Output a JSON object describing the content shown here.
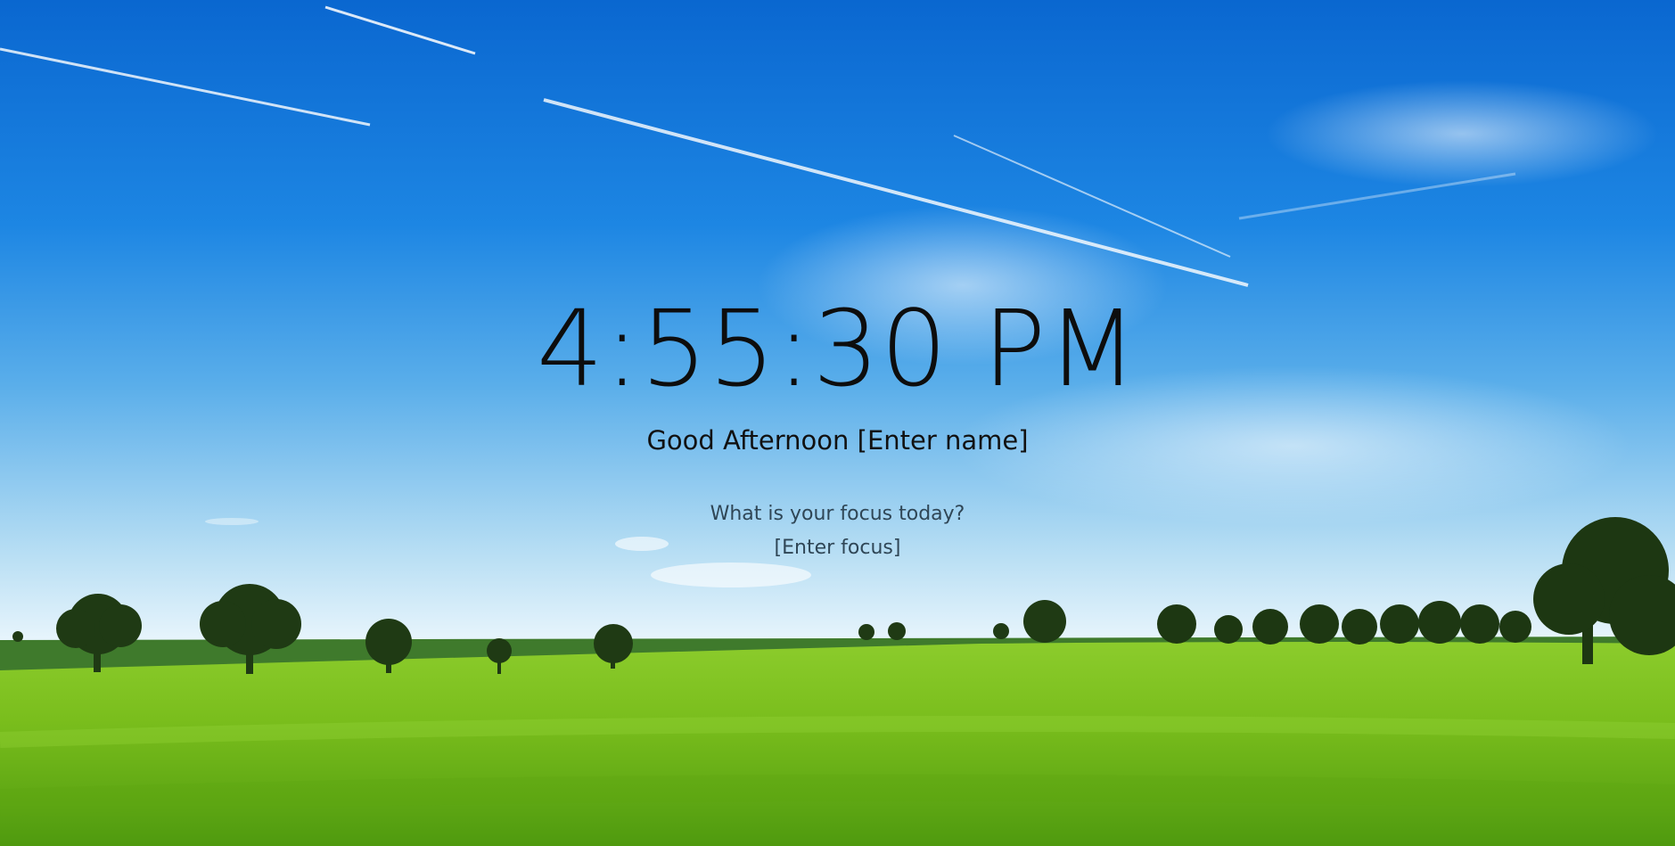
{
  "clock": {
    "time": "4:55:30 PM"
  },
  "greeting": {
    "salutation": "Good Afternoon",
    "name": "[Enter name]"
  },
  "focus": {
    "question": "What is your focus today?",
    "value": "[Enter focus]"
  },
  "colors": {
    "sky_top": "#0a6fd6",
    "sky_bottom": "#bfe2f6",
    "grass": "#7cc21f",
    "text": "#111111"
  }
}
